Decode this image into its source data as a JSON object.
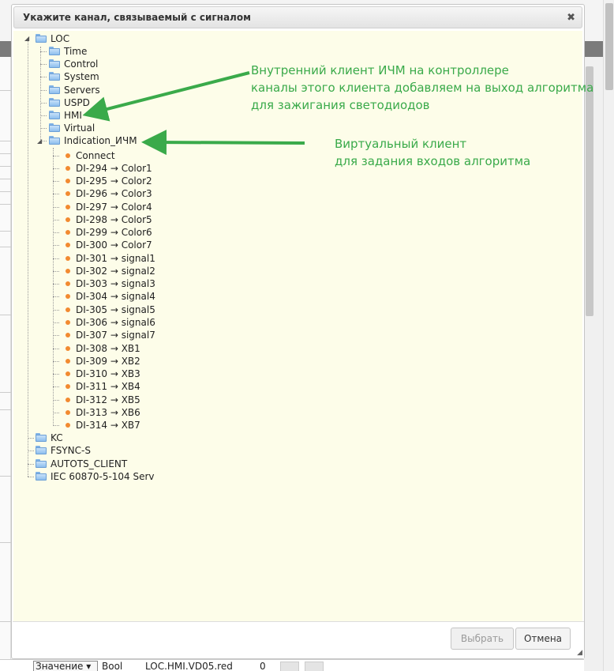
{
  "dialog": {
    "title": "Укажите канал, связываемый с сигналом",
    "close_glyph": "✖",
    "buttons": {
      "select": "Выбрать",
      "cancel": "Отмена"
    }
  },
  "tree": {
    "root": "LOC",
    "children": [
      "Time",
      "Control",
      "System",
      "Servers",
      "USPD",
      "HMI",
      "Virtual",
      "Indication_ИЧМ"
    ],
    "channels": [
      "Connect",
      "DI-294 → Color1",
      "DI-295 → Color2",
      "DI-296 → Color3",
      "DI-297 → Color4",
      "DI-298 → Color5",
      "DI-299 → Color6",
      "DI-300 → Color7",
      "DI-301 → signal1",
      "DI-302 → signal2",
      "DI-303 → signal3",
      "DI-304 → signal4",
      "DI-305 → signal5",
      "DI-306 → signal6",
      "DI-307 → signal7",
      "DI-308 → XB1",
      "DI-309 → XB2",
      "DI-310 → XB3",
      "DI-311 → XB4",
      "DI-312 → XB5",
      "DI-313 → XB6",
      "DI-314 → XB7"
    ],
    "roots_after": [
      "KC",
      "FSYNC-S",
      "AUTOTS_CLIENT",
      "IEC 60870-5-104 Serv"
    ]
  },
  "annotations": {
    "hmi_note": [
      "Внутренний клиент ИЧМ на контроллере",
      "каналы этого клиента добавляем на выход алгоритма",
      "для зажигания светодиодов"
    ],
    "indication_note": [
      "Виртуальный клиент",
      "для задания входов алгоритма"
    ],
    "color": "#3aaa4a"
  },
  "background": {
    "select_value": "Значение",
    "type": "Bool",
    "channel": "LOC.HMI.VD05.red",
    "value": "0"
  }
}
